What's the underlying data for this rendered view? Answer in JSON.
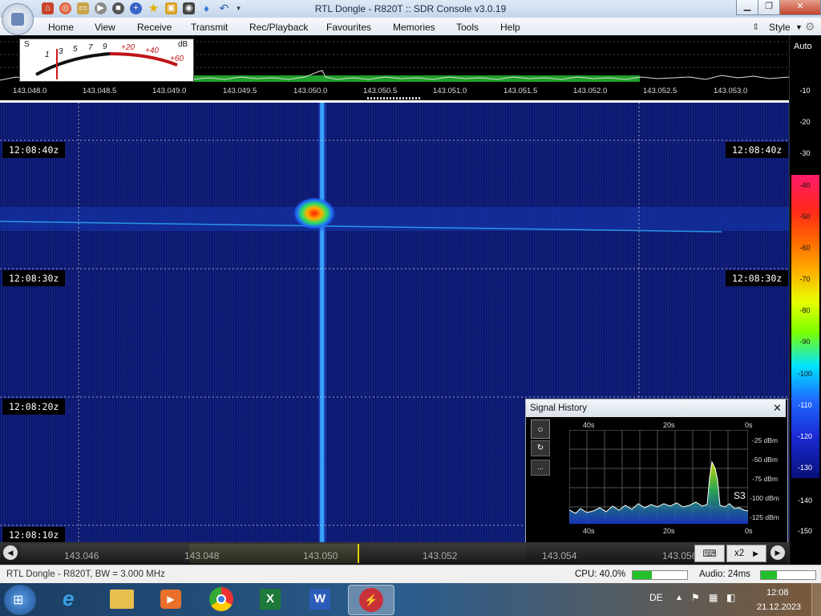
{
  "window": {
    "title": "RTL Dongle - R820T :: SDR Console v3.0.19",
    "style_label": "Style"
  },
  "ribbon": {
    "tabs": [
      "Home",
      "View",
      "Receive",
      "Transmit",
      "Rec/Playback",
      "Favourites",
      "Memories",
      "Tools",
      "Help"
    ]
  },
  "smeter": {
    "s_label": "S",
    "db_label": "dB",
    "marks": [
      "1",
      "3",
      "5",
      "7",
      "9",
      "+20",
      "+40",
      "+60"
    ]
  },
  "spectrum": {
    "auto_label": "Auto",
    "freq_labels": [
      "143.048.0",
      "143.048.5",
      "143.049.0",
      "143.049.5",
      "143.050.0",
      "143.050.5",
      "143.051.0",
      "143.051.5",
      "143.052.0",
      "143.052.5",
      "143.053.0"
    ]
  },
  "waterfall": {
    "time_labels": [
      "12:08:40z",
      "12:08:30z",
      "12:08:20z",
      "12:08:10z"
    ]
  },
  "right_scale": {
    "top_labels": [
      "-10",
      "-20",
      "-30"
    ],
    "color_labels": [
      "-40",
      "-50",
      "-60",
      "-70",
      "-80",
      "-90",
      "-100",
      "-110",
      "-120",
      "-130"
    ],
    "bottom_labels": [
      "-140",
      "-150"
    ],
    "colors": [
      "#ff1a6a",
      "#ff2a1a",
      "#ff6a00",
      "#ffb000",
      "#e6ff00",
      "#7cff00",
      "#00e5ff",
      "#1e6bff",
      "#1a2bd6",
      "#0b0f7a"
    ]
  },
  "signal_history": {
    "title": "Signal History",
    "top_time": [
      "40s",
      "20s",
      "0s"
    ],
    "bottom_time": [
      "40s",
      "20s",
      "0s"
    ],
    "dbm": [
      "-25 dBm",
      "-50 dBm",
      "-75 dBm",
      "-100 dBm",
      "-125 dBm"
    ],
    "s_reading": "S3",
    "ellipsis": "..."
  },
  "tuning": {
    "freqs": [
      "143.046",
      "143.048",
      "143.050",
      "143.052",
      "143.054",
      "143.056"
    ],
    "zoom": "x2"
  },
  "status": {
    "device": "RTL Dongle - R820T, BW = 3.000 MHz",
    "cpu": "CPU: 40.0%",
    "audio": "Audio: 24ms",
    "cpu_level": 0.35,
    "audio_level": 0.3
  },
  "taskbar": {
    "lang": "DE",
    "time": "12:08",
    "date": "21.12.2023"
  }
}
